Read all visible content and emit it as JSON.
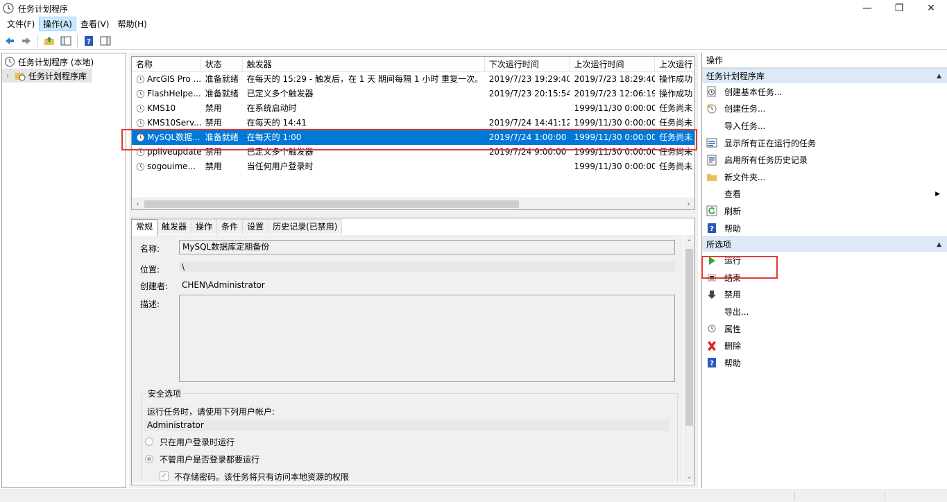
{
  "window": {
    "title": "任务计划程序",
    "min_icon": "minimize-icon",
    "max_icon": "restore-icon",
    "close_icon": "close-icon"
  },
  "menu": [
    {
      "label": "文件(F)",
      "active": false
    },
    {
      "label": "操作(A)",
      "active": true
    },
    {
      "label": "查看(V)",
      "active": false
    },
    {
      "label": "帮助(H)",
      "active": false
    }
  ],
  "tree": {
    "root": "任务计划程序 (本地)",
    "child": "任务计划程序库"
  },
  "list": {
    "headers": [
      "名称",
      "状态",
      "触发器",
      "下次运行时间",
      "上次运行时间",
      "上次运行"
    ],
    "rows": [
      {
        "name": "ArcGIS Pro ...",
        "status": "准备就绪",
        "trigger": "在每天的 15:29 - 触发后，在 1 天 期间每隔 1 小时 重复一次。",
        "next": "2019/7/23 19:29:40",
        "last": "2019/7/23 18:29:40",
        "result": "操作成功"
      },
      {
        "name": "FlashHelpe...",
        "status": "准备就绪",
        "trigger": "已定义多个触发器",
        "next": "2019/7/23 20:15:54",
        "last": "2019/7/23 12:06:19",
        "result": "操作成功"
      },
      {
        "name": "KMS10",
        "status": "禁用",
        "trigger": "在系统启动时",
        "next": "",
        "last": "1999/11/30 0:00:00",
        "result": "任务尚未"
      },
      {
        "name": "KMS10Serv...",
        "status": "禁用",
        "trigger": "在每天的 14:41",
        "next": "2019/7/24 14:41:12",
        "last": "1999/11/30 0:00:00",
        "result": "任务尚未"
      },
      {
        "name": "MySQL数据...",
        "status": "准备就绪",
        "trigger": "在每天的 1:00",
        "next": "2019/7/24 1:00:00",
        "last": "1999/11/30 0:00:00",
        "result": "任务尚未"
      },
      {
        "name": "ppliveupdate",
        "status": "禁用",
        "trigger": "已定义多个触发器",
        "next": "2019/7/24 9:00:00",
        "last": "1999/11/30 0:00:00",
        "result": "任务尚未"
      },
      {
        "name": "sogouime...",
        "status": "禁用",
        "trigger": "当任何用户登录时",
        "next": "",
        "last": "1999/11/30 0:00:00",
        "result": "任务尚未"
      }
    ]
  },
  "detail": {
    "tabs": [
      "常规",
      "触发器",
      "操作",
      "条件",
      "设置",
      "历史记录(已禁用)"
    ],
    "name_label": "名称:",
    "name_value": "MySQL数据库定期备份",
    "location_label": "位置:",
    "location_value": "\\",
    "author_label": "创建者:",
    "author_value": "CHEN\\Administrator",
    "desc_label": "描述:",
    "security_title": "安全选项",
    "run_as_label": "运行任务时，请使用下列用户帐户:",
    "run_as_value": "Administrator",
    "opt1": "只在用户登录时运行",
    "opt2": "不管用户是否登录都要运行",
    "opt3": "不存储密码。该任务将只有访问本地资源的权限"
  },
  "actions": {
    "title": "操作",
    "section1": "任务计划程序库",
    "items1": [
      {
        "label": "创建基本任务...",
        "icon": "create-basic-task-icon"
      },
      {
        "label": "创建任务...",
        "icon": "create-task-icon"
      },
      {
        "label": "导入任务...",
        "icon": ""
      },
      {
        "label": "显示所有正在运行的任务",
        "icon": "running-tasks-icon"
      },
      {
        "label": "启用所有任务历史记录",
        "icon": "history-icon"
      },
      {
        "label": "新文件夹...",
        "icon": "folder-icon"
      },
      {
        "label": "查看",
        "icon": "",
        "submenu": true
      },
      {
        "label": "刷新",
        "icon": "refresh-icon"
      },
      {
        "label": "帮助",
        "icon": "help-icon"
      }
    ],
    "section2": "所选项",
    "items2": [
      {
        "label": "运行",
        "icon": "run-icon"
      },
      {
        "label": "结束",
        "icon": "stop-icon"
      },
      {
        "label": "禁用",
        "icon": "disable-icon"
      },
      {
        "label": "导出...",
        "icon": ""
      },
      {
        "label": "属性",
        "icon": "properties-icon"
      },
      {
        "label": "删除",
        "icon": "delete-icon"
      },
      {
        "label": "帮助",
        "icon": "help-icon"
      }
    ]
  },
  "colors": {
    "selection": "#0078d7",
    "highlight": "#e53935",
    "section_bg": "#dde9f6"
  }
}
